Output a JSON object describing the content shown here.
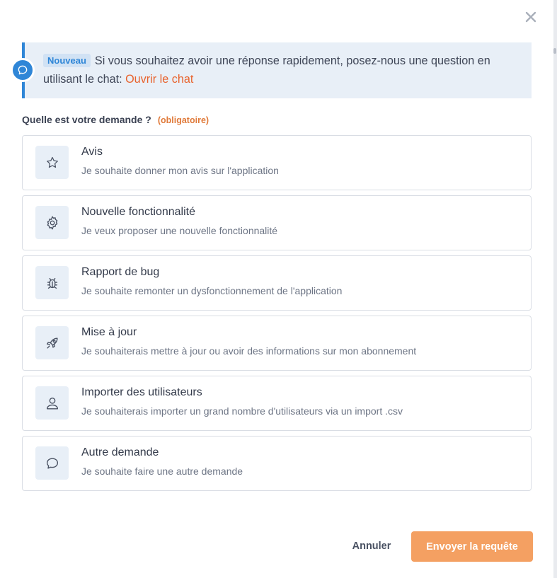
{
  "dialog": {
    "banner": {
      "badge": "Nouveau",
      "message": "Si vous souhaitez avoir une réponse rapidement, posez-nous une question en utilisant le chat: ",
      "link": "Ouvrir le chat"
    },
    "question": {
      "label": "Quelle est votre demande ?",
      "required": "(obligatoire)"
    },
    "options": [
      {
        "icon": "star-icon",
        "title": "Avis",
        "description": "Je souhaite donner mon avis sur l'application"
      },
      {
        "icon": "gear-icon",
        "title": "Nouvelle fonctionnalité",
        "description": "Je veux proposer une nouvelle fonctionnalité"
      },
      {
        "icon": "bug-icon",
        "title": "Rapport de bug",
        "description": "Je souhaite remonter un dysfonctionnement de l'application"
      },
      {
        "icon": "rocket-icon",
        "title": "Mise à jour",
        "description": "Je souhaiterais mettre à jour ou avoir des informations sur mon abonnement"
      },
      {
        "icon": "user-icon",
        "title": "Importer des utilisateurs",
        "description": "Je souhaiterais importer un grand nombre d'utilisateurs via un import .csv"
      },
      {
        "icon": "chat-bubble-icon",
        "title": "Autre demande",
        "description": "Je souhaite faire une autre demande"
      }
    ],
    "footer": {
      "cancel": "Annuler",
      "submit": "Envoyer la requête"
    }
  },
  "colors": {
    "accent_blue": "#2f86d7",
    "accent_orange": "#e8622c",
    "submit_bg": "#f4a062",
    "banner_bg": "#e8eff7"
  }
}
